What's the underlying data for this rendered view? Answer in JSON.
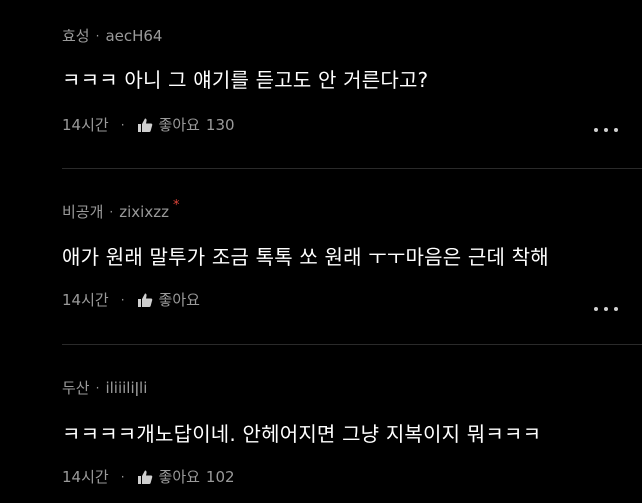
{
  "comments": [
    {
      "author": "효성",
      "user_id": "aecH64",
      "text": "ㅋㅋㅋ 아니 그 얘기를 듣고도 안 거른다고?",
      "time": "14시간",
      "like_label": "좋아요",
      "like_count": "130",
      "badge": ""
    },
    {
      "author": "비공개",
      "user_id": "zixixzz",
      "text": "애가 원래 말투가 조금 톡톡 쏘 원래 ㅜㅜ마음은 근데 착해",
      "time": "14시간",
      "like_label": "좋아요",
      "like_count": "",
      "badge": "*"
    },
    {
      "author": "두산",
      "user_id": "iliiiliǀli",
      "text": "ㅋㅋㅋㅋ개노답이네. 안헤어지면 그냥 지복이지 뭐ㅋㅋㅋ",
      "time": "14시간",
      "like_label": "좋아요",
      "like_count": "102",
      "badge": ""
    }
  ],
  "separator": "·",
  "icons": {
    "like": "thumbs-up-icon",
    "more": "more-options-icon"
  },
  "colors": {
    "background": "#000000",
    "meta_text": "#9a9a9a",
    "body_text": "#ffffff",
    "badge": "#e0453a"
  }
}
